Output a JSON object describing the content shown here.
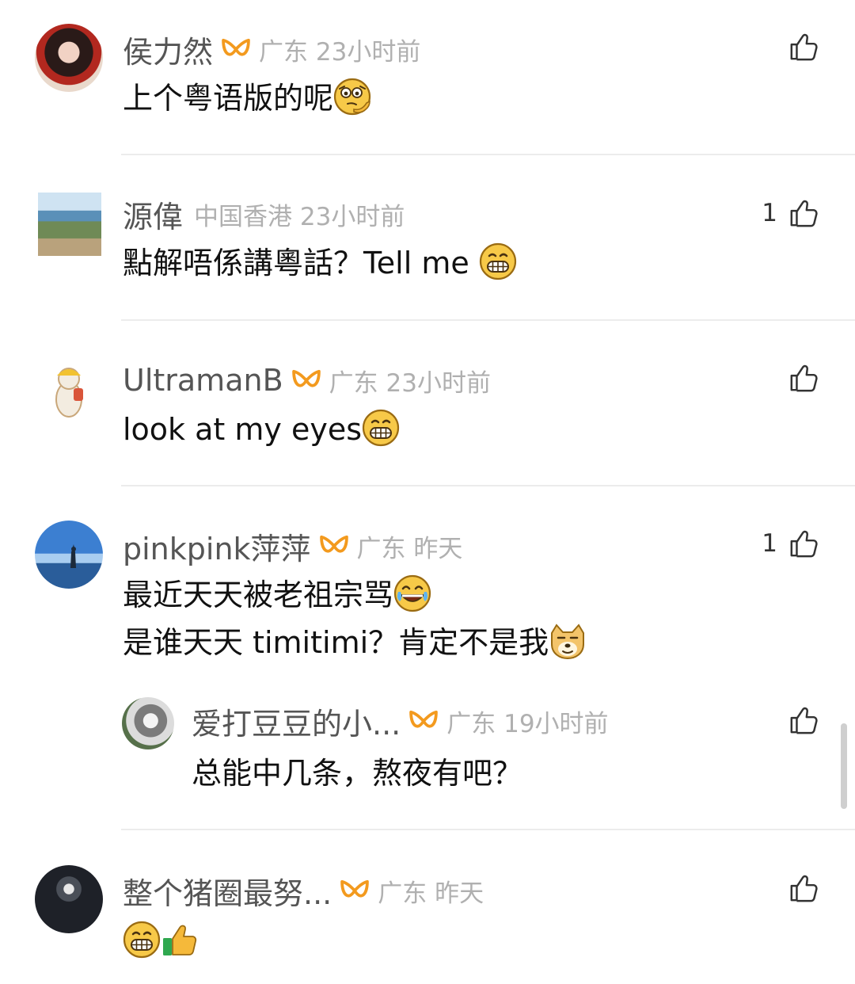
{
  "comments": [
    {
      "name": "侯力然",
      "location": "广东",
      "time": "23小时前",
      "text": "上个粤语版的呢",
      "likes": ""
    },
    {
      "name": "源偉",
      "location": "中国香港",
      "time": "23小时前",
      "text": "點解唔係講粵話？Tell me",
      "likes": "1"
    },
    {
      "name": "UltramanB",
      "location": "广东",
      "time": "23小时前",
      "text": "look at my eyes",
      "likes": ""
    },
    {
      "name": "pinkpink萍萍",
      "location": "广东",
      "time": "昨天",
      "text": "最近天天被老祖宗骂",
      "text2": "是谁天天 timitimi？肯定不是我",
      "likes": "1"
    },
    {
      "name": "爱打豆豆的小...",
      "location": "广东",
      "time": "19小时前",
      "text": "总能中几条，熬夜有吧？",
      "likes": ""
    },
    {
      "name": "整个猪圈最努...",
      "location": "广东",
      "time": "昨天",
      "text": "",
      "likes": ""
    }
  ],
  "icons": {
    "like": "thumbs-up-icon",
    "vip": "vip-badge-icon"
  },
  "colors": {
    "vip_orange": "#f39a1e",
    "name_gray": "#555555",
    "meta_gray": "#b0b0b0",
    "divider": "#ececec"
  }
}
